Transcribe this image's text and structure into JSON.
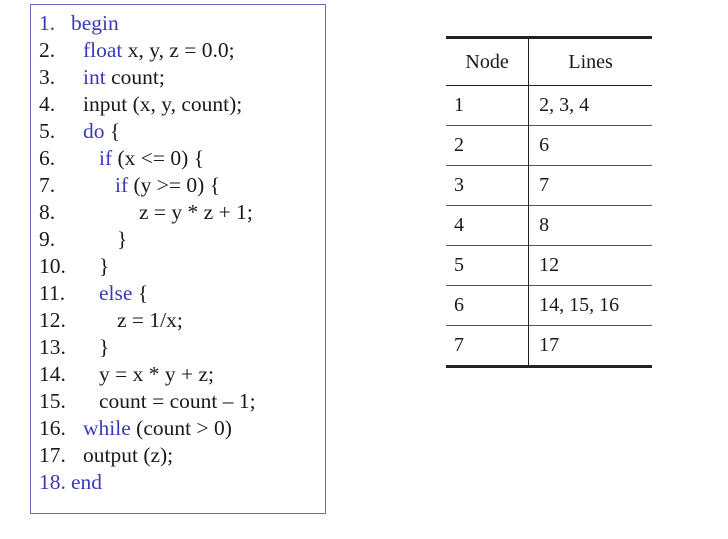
{
  "code": [
    {
      "num": "1.",
      "kw": "begin",
      "rest": ""
    },
    {
      "num": "2.",
      "kw": "float",
      "rest": " x, y, z = 0.0;"
    },
    {
      "num": "3.",
      "kw": "int",
      "rest": " count;"
    },
    {
      "num": "4.",
      "kw": "",
      "rest": "input (x, y, count);"
    },
    {
      "num": "5.",
      "kw": "do",
      "rest": " {"
    },
    {
      "num": "6.",
      "kw": "if",
      "rest": " (x <= 0) {"
    },
    {
      "num": "7.",
      "kw": "if",
      "rest": " (y >= 0) {"
    },
    {
      "num": "8.",
      "kw": "",
      "rest": "z = y * z + 1;"
    },
    {
      "num": "9.",
      "kw": "",
      "rest": "}"
    },
    {
      "num": "10.",
      "kw": "",
      "rest": "}"
    },
    {
      "num": "11.",
      "kw": "else",
      "rest": " {"
    },
    {
      "num": "12.",
      "kw": "",
      "rest": "z = 1/x;"
    },
    {
      "num": "13.",
      "kw": "",
      "rest": "}"
    },
    {
      "num": "14.",
      "kw": "",
      "rest": "y = x * y + z;"
    },
    {
      "num": "15.",
      "kw": "",
      "rest": "count = count – 1;"
    },
    {
      "num": "16.",
      "kw": "while",
      "rest": " (count > 0)"
    },
    {
      "num": "17.",
      "kw": "",
      "rest": "output (z);"
    },
    {
      "num": "18.",
      "kw": "end",
      "rest": ""
    }
  ],
  "table": {
    "headers": {
      "node": "Node",
      "lines": "Lines"
    },
    "rows": [
      {
        "node": "1",
        "lines": "2, 3, 4"
      },
      {
        "node": "2",
        "lines": "6"
      },
      {
        "node": "3",
        "lines": "7"
      },
      {
        "node": "4",
        "lines": "8"
      },
      {
        "node": "5",
        "lines": "12"
      },
      {
        "node": "6",
        "lines": "14, 15, 16"
      },
      {
        "node": "7",
        "lines": "17"
      }
    ]
  },
  "colors": {
    "keyword": "#3a3ab8",
    "border": "#6b6bbf"
  }
}
